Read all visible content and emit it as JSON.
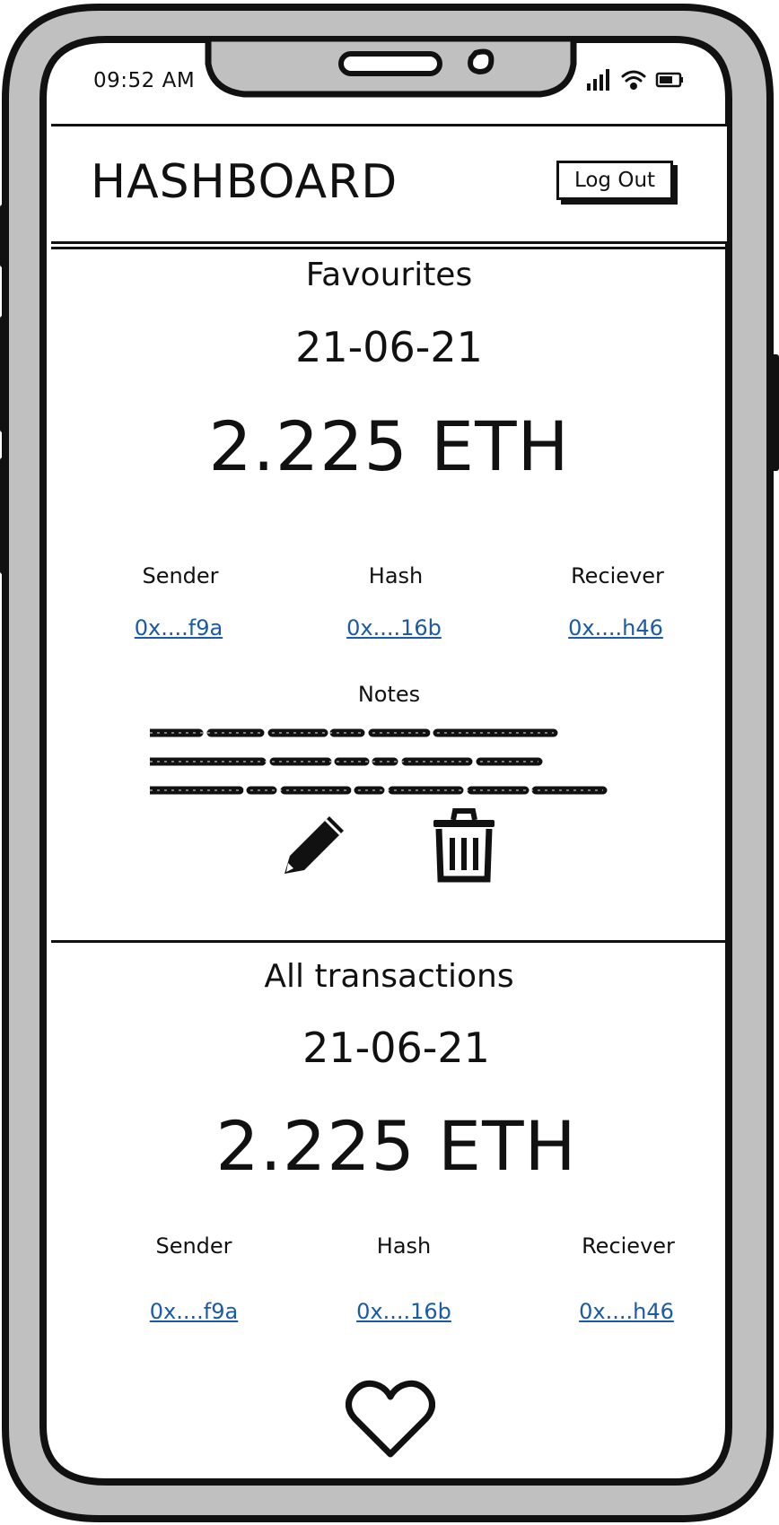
{
  "status_bar": {
    "time": "09:52 AM",
    "icons": [
      "signal-icon",
      "wifi-icon",
      "battery-icon"
    ]
  },
  "header": {
    "title": "HASHBOARD",
    "logout_label": "Log Out"
  },
  "favourites": {
    "title": "Favourites",
    "date": "21-06-21",
    "amount": "2.225 ETH",
    "columns": [
      {
        "label": "Sender",
        "value": "0x....f9a"
      },
      {
        "label": "Hash",
        "value": "0x....16b"
      },
      {
        "label": "Reciever",
        "value": "0x....h46"
      }
    ],
    "notes_label": "Notes",
    "actions": [
      "pencil-icon",
      "trash-icon"
    ]
  },
  "all_transactions": {
    "title": "All transactions",
    "date": "21-06-21",
    "amount": "2.225 ETH",
    "columns": [
      {
        "label": "Sender",
        "value": "0x....f9a"
      },
      {
        "label": "Hash",
        "value": "0x....16b"
      },
      {
        "label": "Reciever",
        "value": "0x....h46"
      }
    ],
    "actions": [
      "heart-icon"
    ]
  },
  "colors": {
    "frame": "#c0c0c0",
    "outline": "#111111",
    "link": "#1a5aa6"
  }
}
